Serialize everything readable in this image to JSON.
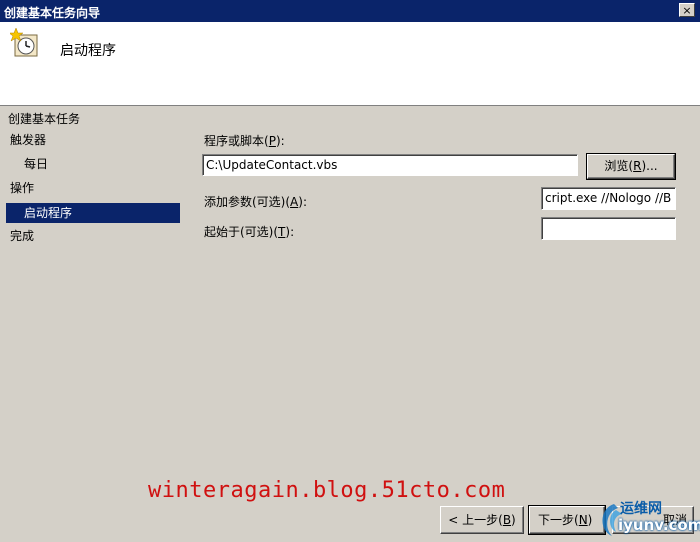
{
  "window": {
    "title": "创建基本任务向导",
    "close_glyph": "×"
  },
  "header": {
    "title": "启动程序",
    "icon": "clock-task-icon"
  },
  "section_title": "创建基本任务",
  "nav": {
    "items": [
      {
        "label": "触发器"
      },
      {
        "label": "每日"
      },
      {
        "label": "操作"
      },
      {
        "label": "启动程序"
      },
      {
        "label": "完成"
      }
    ]
  },
  "form": {
    "program": {
      "label_pre": "程序或脚本(",
      "label_key": "P",
      "label_post": "):",
      "value": "C:\\UpdateContact.vbs"
    },
    "browse": {
      "label_pre": "浏览(",
      "label_key": "R",
      "label_post": ")..."
    },
    "args": {
      "label_pre": "添加参数(可选)(",
      "label_key": "A",
      "label_post": "):",
      "value": "cript.exe //Nologo //B"
    },
    "startin": {
      "label_pre": "起始于(可选)(",
      "label_key": "T",
      "label_post": "):",
      "value": ""
    }
  },
  "buttons": {
    "back": {
      "label_pre": "< 上一步(",
      "label_key": "B",
      "label_post": ")"
    },
    "next": {
      "label_pre": "下一步(",
      "label_key": "N",
      "label_post": ")"
    },
    "cancel": {
      "label": "取消"
    }
  },
  "watermark": "winteragain.blog.51cto.com",
  "logo": {
    "cn": "运维网",
    "en": "iyunv.com"
  }
}
